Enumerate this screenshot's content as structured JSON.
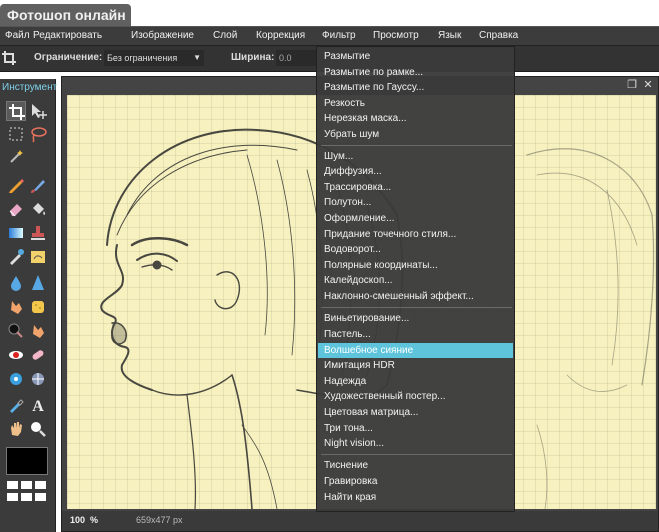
{
  "app": {
    "title": "Фотошоп онлайн"
  },
  "menubar": {
    "items": [
      "Файл",
      "Редактировать",
      "Изображение",
      "Слой",
      "Коррекция",
      "Фильтр",
      "Просмотр",
      "Язык",
      "Справка"
    ]
  },
  "options": {
    "constraint_label": "Ограничение:",
    "constraint_value": "Без ограничения",
    "width_label": "Ширина:",
    "width_value": "0.0"
  },
  "toolpanel": {
    "title": "Инструмент",
    "tools": [
      "crop-icon",
      "move-icon",
      "marquee-icon",
      "lasso-icon",
      "magic-wand-icon",
      "pencil-icon",
      "brush-icon",
      "eraser-icon",
      "fill-bucket-icon",
      "gradient-icon",
      "stamp-icon",
      "color-replace-icon",
      "draw-icon",
      "blur-icon",
      "sharpen-icon",
      "smudge-icon",
      "sponge-icon",
      "burn-icon",
      "dodge-icon",
      "red-eye-icon",
      "spot-heal-icon",
      "bloat-icon",
      "pinch-icon",
      "color-picker-icon",
      "type-icon",
      "hand-icon",
      "zoom-icon"
    ],
    "foreground_color": "#000000"
  },
  "canvas": {
    "zoom": "100",
    "zoom_unit": "%",
    "size": "659x477 px",
    "paper_color": "#f6f1bf"
  },
  "filter_menu": {
    "groups": [
      [
        "Размытие",
        "Размытие по рамке...",
        "Размытие по Гауссу...",
        "Резкость",
        "Нерезкая маска...",
        "Убрать шум"
      ],
      [
        "Шум...",
        "Диффузия...",
        "Трассировка...",
        "Полутон...",
        "Оформление...",
        "Придание точечного стиля...",
        "Водоворот...",
        "Полярные координаты...",
        "Калейдоскоп...",
        "Наклонно-смешенный эффект..."
      ],
      [
        "Виньетирование...",
        "Пастель...",
        "Волшебное сияние",
        "Имитация HDR",
        "Надежда",
        "Художественный постер...",
        "Цветовая матрица...",
        "Три тона...",
        "Night vision..."
      ],
      [
        "Тиснение",
        "Гравировка",
        "Найти края"
      ]
    ],
    "highlighted": "Волшебное сияние",
    "highlight_color": "#5ec4dc"
  }
}
